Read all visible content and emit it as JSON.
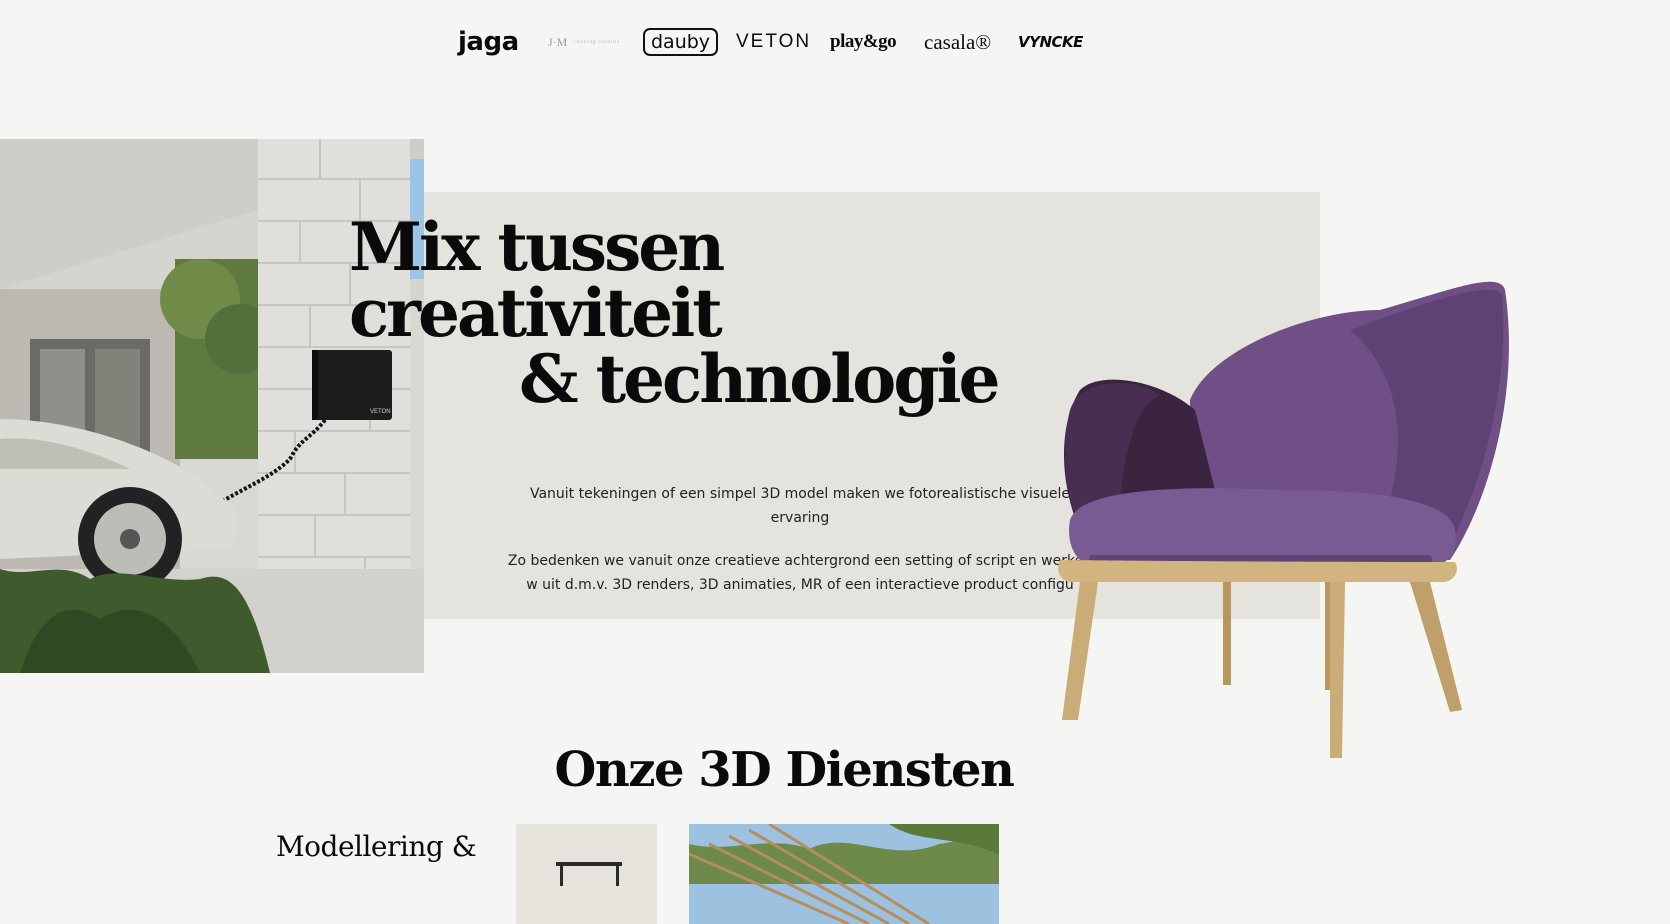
{
  "brand_logos": [
    {
      "name": "jaga",
      "text": "jaga"
    },
    {
      "name": "jm",
      "text": "J·M",
      "subtext": "cooking studios"
    },
    {
      "name": "dauby",
      "text": "dauby"
    },
    {
      "name": "veton",
      "text": "VETON"
    },
    {
      "name": "playgo",
      "text": "play&go"
    },
    {
      "name": "casala",
      "text": "casala®"
    },
    {
      "name": "vyncke",
      "text": "VYNCKE"
    }
  ],
  "hero": {
    "headline": [
      "Mix tussen",
      "creativiteit",
      "& technologie"
    ],
    "paragraphs": [
      "Vanuit tekeningen of een simpel 3D model maken we fotorealistische visuele ervaring",
      "Zo bedenken we vanuit onze creatieve achtergrond een setting of script en werken w uit d.m.v. 3D renders, 3D animaties, MR of een interactieve product configu"
    ],
    "charger_label": "VETON"
  },
  "services": {
    "title": "Onze 3D Diensten",
    "first_item_title": "Modellering &"
  },
  "colors": {
    "background": "#f5f5f4",
    "beige_panel": "#e5e3de",
    "text": "#0a0a0a",
    "chair_fabric": "#6f4f86",
    "chair_wood": "#c9ac78"
  }
}
